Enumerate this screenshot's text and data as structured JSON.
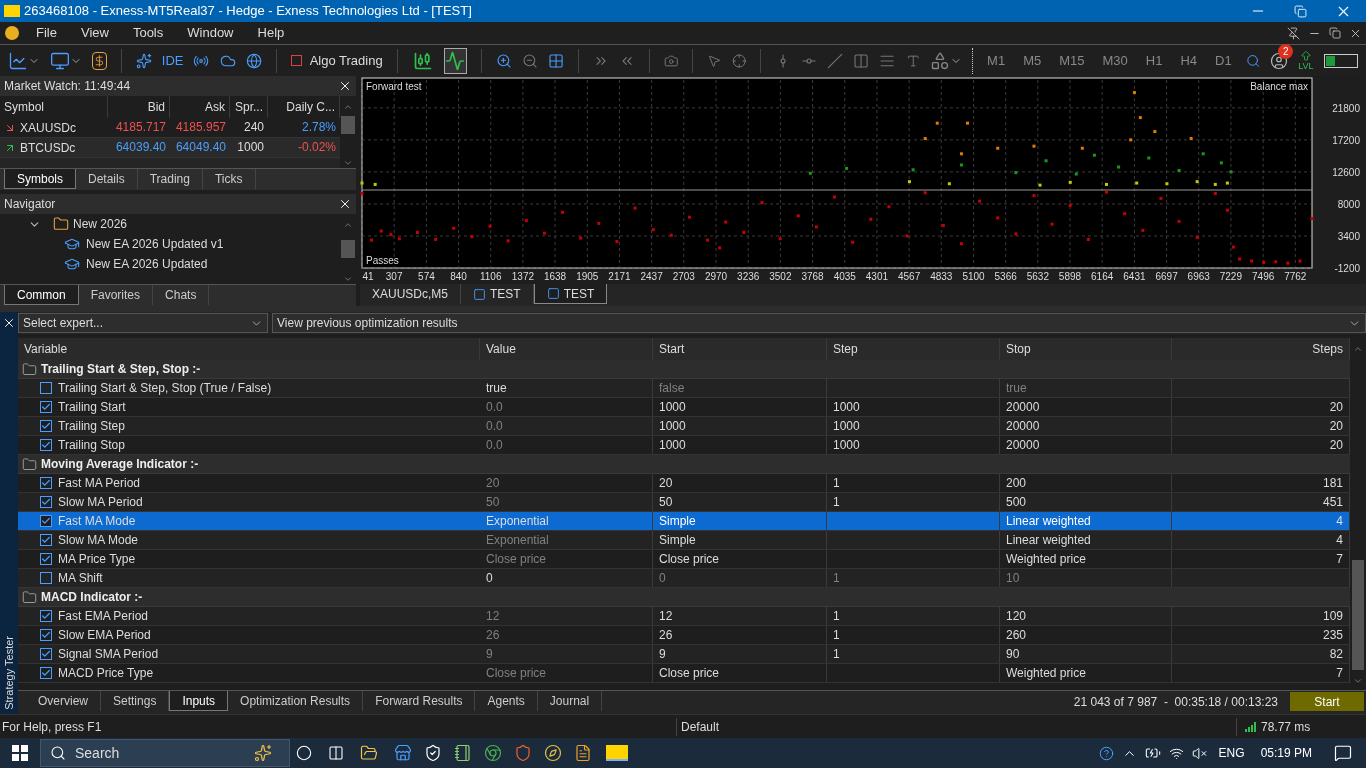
{
  "window": {
    "title": "263468108 - Exness-MT5Real37 - Hedge - Exness Technologies Ltd - [TEST]"
  },
  "menu": [
    "File",
    "View",
    "Tools",
    "Window",
    "Help"
  ],
  "toolbar": {
    "ide_label": "IDE",
    "algo_trading": {
      "label": "Algo Trading",
      "on": false
    },
    "view_buttons": [
      {
        "selected": false
      },
      {
        "selected": true
      }
    ],
    "timeframes": [
      {
        "label": "M1",
        "selected": false
      },
      {
        "label": "M5",
        "selected": false
      },
      {
        "label": "M15",
        "selected": false
      },
      {
        "label": "M30",
        "selected": false
      },
      {
        "label": "H1",
        "selected": false
      },
      {
        "label": "H4",
        "selected": false
      },
      {
        "label": "D1",
        "selected": false
      }
    ],
    "notification_count": "2",
    "lvl_label": "LVL"
  },
  "market_watch": {
    "title": "Market Watch: 11:49:44",
    "columns": [
      "Symbol",
      "Bid",
      "Ask",
      "Spr...",
      "Daily C..."
    ],
    "rows": [
      {
        "symbol": "XAUUSDc",
        "rising": false,
        "bid": "4185.717",
        "ask": "4185.957",
        "spread": "240",
        "change": "2.78%",
        "change_positive": true
      },
      {
        "symbol": "BTCUSDc",
        "rising": true,
        "bid": "64039.40",
        "ask": "64049.40",
        "spread": "1000",
        "change": "-0.02%",
        "change_positive": false
      }
    ],
    "tabs": [
      {
        "label": "Symbols",
        "selected": true
      },
      {
        "label": "Details",
        "selected": false
      },
      {
        "label": "Trading",
        "selected": false
      },
      {
        "label": "Ticks",
        "selected": false
      }
    ]
  },
  "navigator": {
    "title": "Navigator",
    "tree": [
      {
        "label": "New 2026",
        "expanded": true,
        "children": [
          {
            "label": "New EA 2026 Updated v1"
          },
          {
            "label": "New EA 2026 Updated"
          }
        ]
      }
    ],
    "tabs": [
      {
        "label": "Common",
        "selected": true
      },
      {
        "label": "Favorites",
        "selected": false
      },
      {
        "label": "Chats",
        "selected": false
      }
    ]
  },
  "chart": {
    "chart_data": {
      "type": "scatter",
      "title": "Forward test",
      "ylabel": "Balance max",
      "xlabel": "Passes",
      "xlim": [
        41,
        7900
      ],
      "ylim": [
        -1200,
        25800
      ],
      "xticks": [
        41,
        307,
        574,
        840,
        1106,
        1372,
        1638,
        1905,
        2171,
        2437,
        2703,
        2970,
        3236,
        3502,
        3768,
        4035,
        4301,
        4567,
        4833,
        5100,
        5366,
        5632,
        5898,
        6164,
        6431,
        6697,
        6963,
        7229,
        7496,
        7762
      ],
      "yticks": [
        -1200,
        3400,
        8000,
        12600,
        17200,
        21800
      ],
      "grid": true,
      "ref_lines": [
        {
          "axis": "y",
          "value": 10000
        }
      ],
      "series": [
        {
          "color": "#c80000",
          "x": [
            41,
            120,
            200,
            280,
            350,
            500,
            650,
            800,
            950,
            1100,
            1250,
            1400,
            1550,
            1700,
            1850,
            2000,
            2150,
            2300,
            2450,
            2600,
            2750,
            2900,
            3050,
            3200,
            3350,
            3500,
            3650,
            3800,
            3950,
            4100,
            4250,
            4400,
            4550,
            4700,
            4850,
            5000,
            5150,
            5300,
            5450,
            5600,
            5750,
            5900,
            6050,
            6200,
            6350,
            6500,
            6650,
            6800,
            6950,
            7100,
            7200,
            7250,
            7300,
            7400,
            7500,
            7600,
            7700,
            7800,
            7900,
            3000
          ],
          "values": [
            9500,
            2800,
            4100,
            3600,
            3000,
            3900,
            2900,
            4500,
            3300,
            4800,
            2700,
            5600,
            3800,
            6800,
            3100,
            5200,
            2600,
            7400,
            4300,
            3500,
            6100,
            2800,
            5400,
            3900,
            8200,
            3000,
            6300,
            4700,
            9000,
            2500,
            5800,
            7600,
            3400,
            9600,
            4900,
            2300,
            8400,
            6000,
            3700,
            9200,
            5100,
            7800,
            2900,
            9700,
            6600,
            4200,
            8800,
            5500,
            3200,
            9500,
            7100,
            1800,
            100,
            -200,
            -400,
            -300,
            -500,
            -200,
            5900,
            1700
          ]
        },
        {
          "color": "#c8c800",
          "x": [
            41,
            150,
            4570,
            4900,
            5650,
            5900,
            6200,
            6450,
            6700,
            6950,
            7100,
            7200
          ],
          "values": [
            11000,
            10800,
            11200,
            10900,
            10700,
            11100,
            10800,
            11000,
            10900,
            11200,
            10800,
            11000
          ]
        },
        {
          "color": "#1a9a1a",
          "x": [
            3750,
            4050,
            4600,
            5000,
            5450,
            5700,
            5950,
            6100,
            6300,
            6550,
            6800,
            7000,
            7150,
            7230
          ],
          "values": [
            12400,
            13100,
            12900,
            13600,
            12500,
            14200,
            12300,
            15000,
            13300,
            14600,
            12800,
            15200,
            13900,
            12600
          ]
        },
        {
          "color": "#e07b00",
          "x": [
            4700,
            4800,
            5050,
            5000,
            5300,
            5600,
            6000,
            6431,
            6400,
            6600,
            6900,
            6480
          ],
          "values": [
            17400,
            19600,
            19600,
            15200,
            16000,
            16300,
            16000,
            24000,
            17200,
            18400,
            17400,
            20400
          ]
        }
      ]
    },
    "tabs": [
      {
        "label": "XAUUSDc,M5",
        "selected": false,
        "kind": "chart"
      },
      {
        "label": "TEST",
        "selected": false,
        "kind": "tester"
      },
      {
        "label": "TEST",
        "selected": true,
        "kind": "tester"
      }
    ]
  },
  "tester": {
    "side_label": "Strategy Tester",
    "expert": "Select expert...",
    "results": "View previous optimization results",
    "columns": [
      "Variable",
      "Value",
      "Start",
      "Step",
      "Stop",
      "Steps"
    ],
    "rows": [
      {
        "kind": "group",
        "label": "Trailing Start & Step, Stop :-"
      },
      {
        "kind": "param",
        "label": "Trailing Start & Step, Stop (True / False)",
        "checked": false,
        "selected": false,
        "value": "true",
        "start": "false",
        "stop": "true"
      },
      {
        "kind": "param",
        "label": "Trailing Start",
        "checked": true,
        "selected": false,
        "value": "0.0",
        "start": "1000",
        "step": "1000",
        "stop": "20000",
        "steps": "20"
      },
      {
        "kind": "param",
        "label": "Trailing Step",
        "checked": true,
        "selected": false,
        "value": "0.0",
        "start": "1000",
        "step": "1000",
        "stop": "20000",
        "steps": "20"
      },
      {
        "kind": "param",
        "label": "Trailing Stop",
        "checked": true,
        "selected": false,
        "value": "0.0",
        "start": "1000",
        "step": "1000",
        "stop": "20000",
        "steps": "20"
      },
      {
        "kind": "group",
        "label": "Moving Average Indicator :-"
      },
      {
        "kind": "param",
        "label": "Fast MA Period",
        "checked": true,
        "selected": false,
        "value": "20",
        "start": "20",
        "step": "1",
        "stop": "200",
        "steps": "181"
      },
      {
        "kind": "param",
        "label": "Slow MA Period",
        "checked": true,
        "selected": false,
        "value": "50",
        "start": "50",
        "step": "1",
        "stop": "500",
        "steps": "451"
      },
      {
        "kind": "param",
        "label": "Fast MA Mode",
        "checked": true,
        "selected": true,
        "value": "Exponential",
        "start": "Simple",
        "stop": "Linear weighted",
        "steps": "4"
      },
      {
        "kind": "param",
        "label": "Slow MA Mode",
        "checked": true,
        "selected": false,
        "value": "Exponential",
        "start": "Simple",
        "stop": "Linear weighted",
        "steps": "4"
      },
      {
        "kind": "param",
        "label": "MA Price Type",
        "checked": true,
        "selected": false,
        "value": "Close price",
        "start": "Close price",
        "stop": "Weighted price",
        "steps": "7"
      },
      {
        "kind": "param",
        "label": "MA Shift",
        "checked": false,
        "selected": false,
        "value": "0",
        "start": "0",
        "step": "1",
        "stop": "10"
      },
      {
        "kind": "group",
        "label": "MACD Indicator :-"
      },
      {
        "kind": "param",
        "label": "Fast EMA Period",
        "checked": true,
        "selected": false,
        "value": "12",
        "start": "12",
        "step": "1",
        "stop": "120",
        "steps": "109"
      },
      {
        "kind": "param",
        "label": "Slow EMA Period",
        "checked": true,
        "selected": false,
        "value": "26",
        "start": "26",
        "step": "1",
        "stop": "260",
        "steps": "235"
      },
      {
        "kind": "param",
        "label": "Signal SMA Period",
        "checked": true,
        "selected": false,
        "value": "9",
        "start": "9",
        "step": "1",
        "stop": "90",
        "steps": "82"
      },
      {
        "kind": "param",
        "label": "MACD Price Type",
        "checked": true,
        "selected": false,
        "value": "Close price",
        "start": "Close price",
        "stop": "Weighted price",
        "steps": "7"
      }
    ],
    "tabs": [
      {
        "label": "Overview",
        "selected": false
      },
      {
        "label": "Settings",
        "selected": false
      },
      {
        "label": "Inputs",
        "selected": true
      },
      {
        "label": "Optimization Results",
        "selected": false
      },
      {
        "label": "Forward Results",
        "selected": false
      },
      {
        "label": "Agents",
        "selected": false
      },
      {
        "label": "Journal",
        "selected": false
      }
    ],
    "progress": "21 043 of 7 987  -  00:35:18 / 00:13:23",
    "start_button": "Start"
  },
  "status_bar": {
    "help": "For Help, press F1",
    "profile": "Default",
    "ping": "78.77 ms"
  },
  "taskbar": {
    "search_placeholder": "Search",
    "language": "ENG",
    "time": "05:19 PM"
  }
}
